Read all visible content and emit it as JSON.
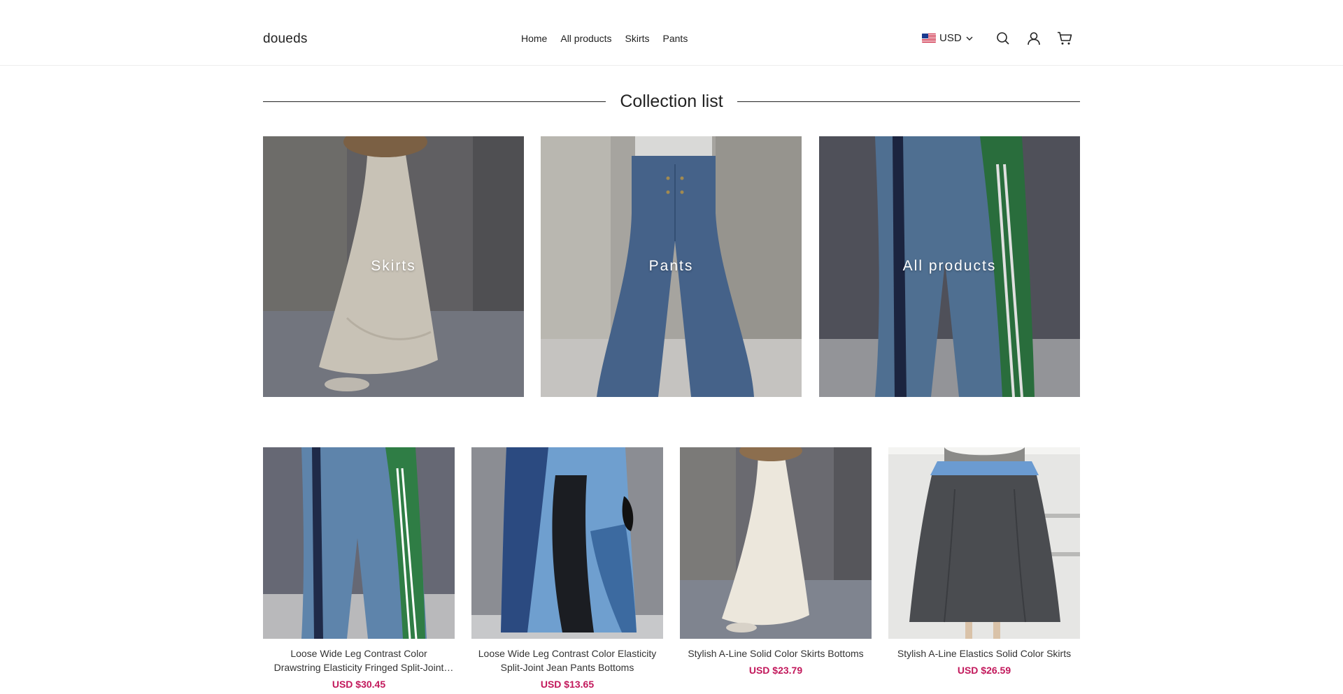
{
  "header": {
    "logo": "doueds",
    "nav": [
      "Home",
      "All products",
      "Skirts",
      "Pants"
    ],
    "currency": "USD",
    "icons": [
      "us-flag-icon",
      "chevron-down-icon",
      "search-icon",
      "account-icon",
      "cart-icon"
    ]
  },
  "section": {
    "title": "Collection list"
  },
  "collections": [
    {
      "label": "Skirts"
    },
    {
      "label": "Pants"
    },
    {
      "label": "All products"
    }
  ],
  "products": [
    {
      "name": "Loose Wide Leg Contrast Color Drawstring Elasticity Fringed Split-Joint Jean Pants Bottoms",
      "price": "USD $30.45"
    },
    {
      "name": "Loose Wide Leg Contrast Color Elasticity Split-Joint Jean Pants Bottoms",
      "price": "USD $13.65"
    },
    {
      "name": "Stylish A-Line Solid Color Skirts Bottoms",
      "price": "USD $23.79"
    },
    {
      "name": "Stylish A-Line Elastics Solid Color Skirts",
      "price": "USD $26.59"
    }
  ],
  "colors": {
    "price": "#c2185b",
    "text": "#222222",
    "border": "#ededed"
  }
}
